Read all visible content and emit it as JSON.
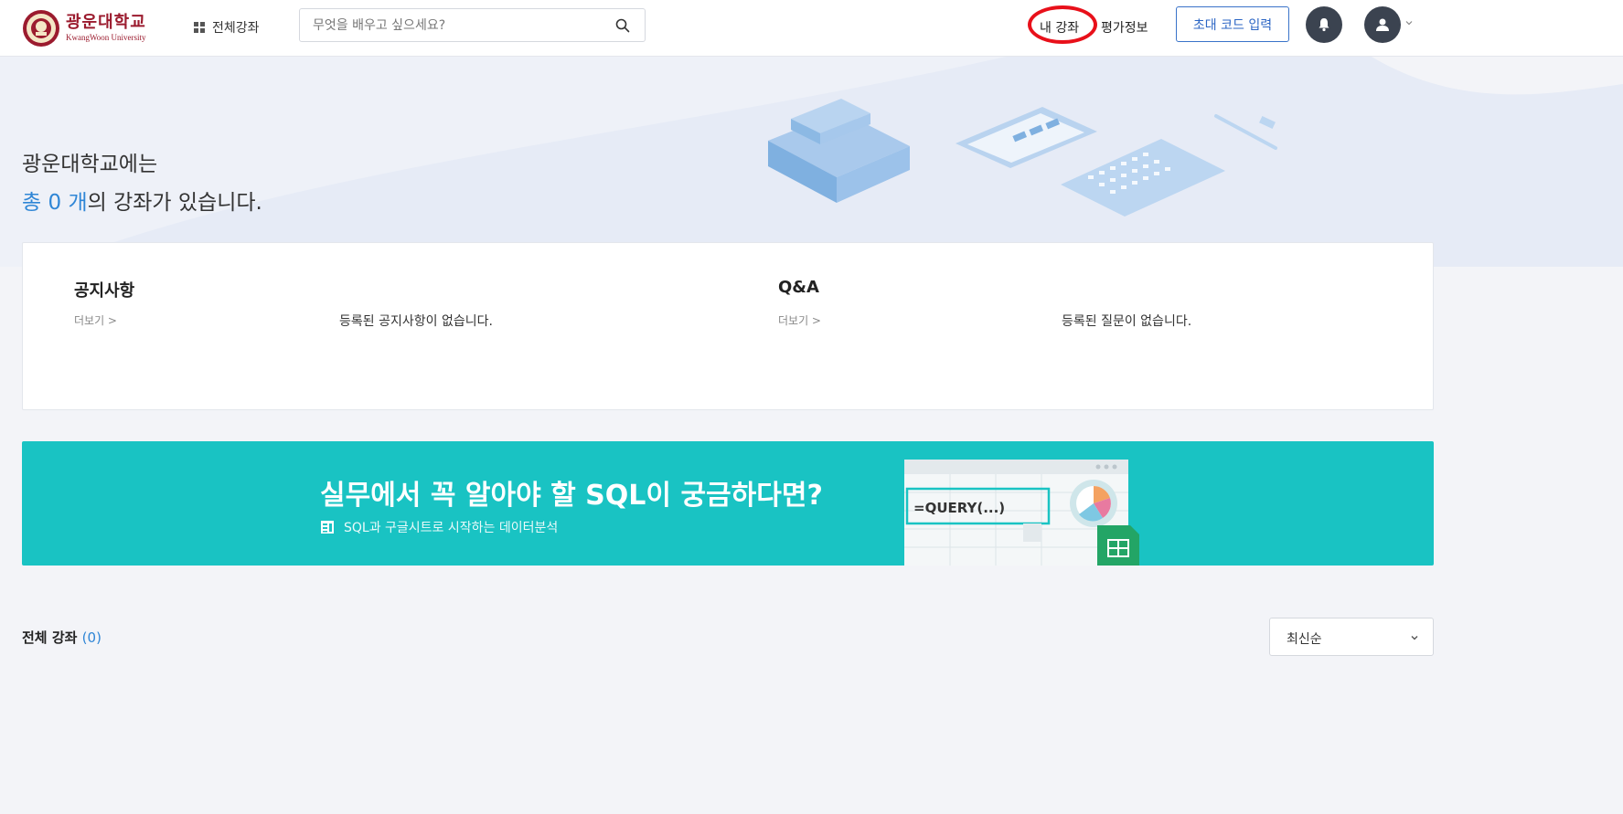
{
  "header": {
    "logo": {
      "name_kr": "광운대학교",
      "name_en": "KwangWoon University",
      "icon": "university-seal-icon"
    },
    "all_courses_label": "전체강좌",
    "search": {
      "placeholder": "무엇을 배우고 싶으세요?",
      "value": "",
      "icon": "search-icon"
    },
    "nav": {
      "my_courses": "내 강좌",
      "evaluation": "평가정보"
    },
    "invite_button": "초대 코드 입력",
    "notification_icon": "bell-icon",
    "user_icon": "user-avatar-icon",
    "highlight_color": "#e8101a"
  },
  "hero": {
    "line1": "광운대학교에는",
    "count_prefix": "총",
    "count": "0",
    "count_unit": "개",
    "line2_suffix": "의 강좌가 있습니다.",
    "accent_color": "#2f86d6"
  },
  "notice_card": {
    "notice": {
      "title": "공지사항",
      "more": "더보기 >",
      "empty": "등록된 공지사항이 없습니다."
    },
    "qna": {
      "title": "Q&A",
      "more": "더보기 >",
      "empty": "등록된 질문이 없습니다."
    }
  },
  "banner": {
    "title": "실무에서 꼭 알아야 할 SQL이 궁금하다면?",
    "subtitle": "SQL과 구글시트로 시작하는 데이터분석",
    "formula": "=QUERY(...)",
    "background_color": "#19c3c3"
  },
  "courses_section": {
    "title": "전체 강좌",
    "count": "(0)",
    "sort": {
      "selected": "최신순"
    }
  }
}
